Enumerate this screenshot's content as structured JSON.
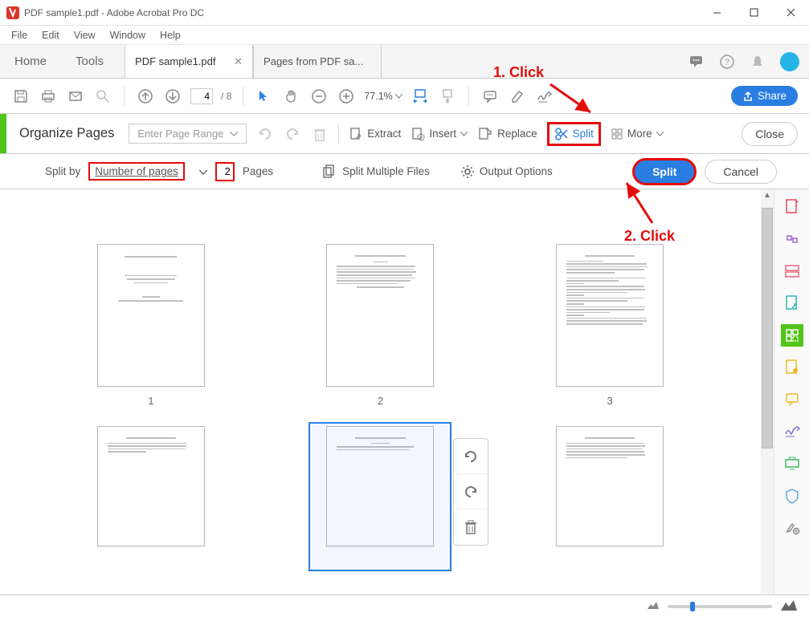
{
  "window": {
    "title": "PDF sample1.pdf - Adobe Acrobat Pro DC"
  },
  "menu": {
    "file": "File",
    "edit": "Edit",
    "view": "View",
    "window": "Window",
    "help": "Help"
  },
  "tabs": {
    "home": "Home",
    "tools": "Tools",
    "docs": [
      {
        "label": "PDF sample1.pdf"
      },
      {
        "label": "Pages from PDF sa..."
      }
    ]
  },
  "toptoolbar": {
    "page_current": "4",
    "page_total": "/ 8",
    "zoom_pct": "77.1%",
    "share": "Share"
  },
  "organize": {
    "title": "Organize Pages",
    "page_range_placeholder": "Enter Page Range",
    "extract": "Extract",
    "insert": "Insert",
    "replace": "Replace",
    "split": "Split",
    "more": "More",
    "close": "Close"
  },
  "splitbar": {
    "splitby": "Split by",
    "mode": "Number of pages",
    "value": "2",
    "pages": "Pages",
    "multi": "Split Multiple Files",
    "options": "Output Options",
    "split": "Split",
    "cancel": "Cancel"
  },
  "thumbs": {
    "nums": [
      "1",
      "2",
      "3"
    ]
  },
  "annotations": {
    "click1": "1. Click",
    "click2": "2. Click"
  }
}
